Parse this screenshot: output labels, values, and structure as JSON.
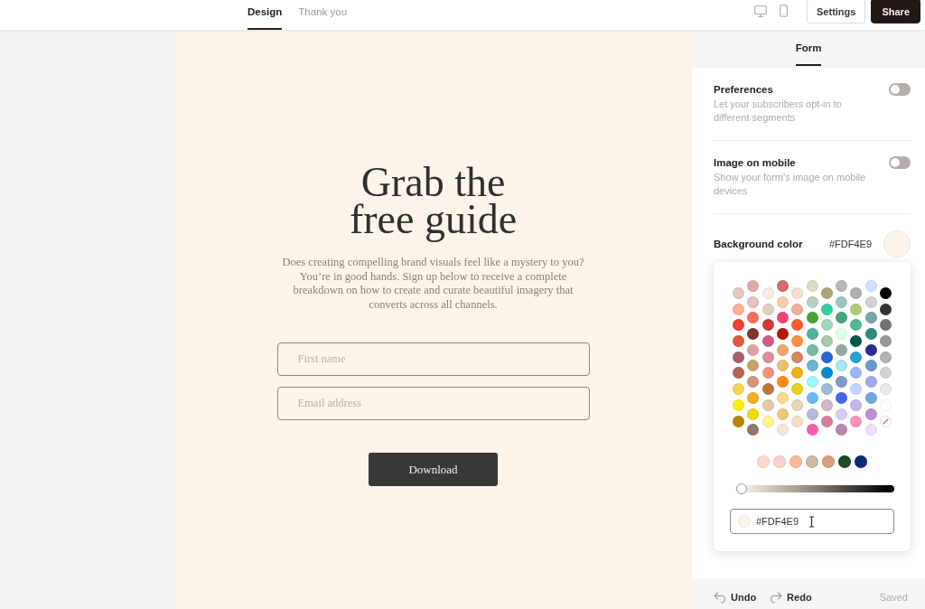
{
  "top_bar": {
    "tabs": [
      {
        "label": "Design",
        "selected": true
      },
      {
        "label": "Thank you",
        "selected": false
      }
    ],
    "buttons": [
      {
        "label": "Settings",
        "kind": "outline"
      },
      {
        "label": "Share",
        "kind": "primary"
      }
    ]
  },
  "canvas": {
    "heading": "Grab the free guide",
    "description": "Does creating compelling brand visuals feel like a mystery to you? You’re in good hands. Sign up below to receive a complete breakdown on how to create and curate beautiful imagery that converts across all channels.",
    "fields": [
      {
        "placeholder": "First name"
      },
      {
        "placeholder": "Email address"
      }
    ],
    "button": "Download"
  },
  "panel": {
    "tabs": [
      {
        "label": "Form",
        "selected": true
      }
    ],
    "settings": [
      {
        "title": "Preferences",
        "description": "Let your subscribers opt-in to different segments",
        "on": false
      },
      {
        "title": "Image on mobile",
        "description": "Show your form's image on mobile devices",
        "on": false
      }
    ],
    "background_color": {
      "label": "Background color",
      "value": "#FDF4E9",
      "color": "#fdf4e9"
    },
    "color_picker": {
      "palette": [
        {
          "swatches": [
            {
              "color": "#e6c8bf"
            },
            {
              "color": "#fcb095"
            },
            {
              "color": "#f43c2f"
            },
            {
              "color": "#e2573c"
            },
            {
              "color": "#a8606d"
            },
            {
              "color": "#ba6253"
            },
            {
              "color": "#f6d352"
            },
            {
              "color": "#fff000"
            },
            {
              "color": "#b8860b"
            }
          ]
        },
        {
          "swatches": [
            {
              "color": "#dfa9a1"
            },
            {
              "color": "#ebc0c0"
            },
            {
              "color": "#fe6a5a"
            },
            {
              "color": "#7b3a28"
            },
            {
              "color": "#dea2a5"
            },
            {
              "color": "#c9a26a"
            },
            {
              "color": "#d4967a"
            },
            {
              "color": "#eeb01c"
            },
            {
              "color": "#f7d900"
            },
            {
              "color": "#8f786c"
            }
          ]
        },
        {
          "swatches": [
            {
              "color": "#f8ebe6"
            },
            {
              "color": "#ddd0c0"
            },
            {
              "color": "#d0383d"
            },
            {
              "color": "#d05a8a"
            },
            {
              "color": "#d88f9b"
            },
            {
              "color": "#ef937f"
            },
            {
              "color": "#b7773e"
            },
            {
              "color": "#e7c8ae"
            },
            {
              "color": "#fff38a"
            }
          ]
        },
        {
          "swatches": [
            {
              "color": "#d46a6a"
            },
            {
              "color": "#fccba8"
            },
            {
              "color": "#ff4179"
            },
            {
              "color": "#b11a00"
            },
            {
              "color": "#eca674"
            },
            {
              "color": "#e8c36a"
            },
            {
              "color": "#ff8c10"
            },
            {
              "color": "#f8db8c"
            },
            {
              "color": "#ecc878"
            },
            {
              "color": "#f2e6d8"
            }
          ]
        },
        {
          "swatches": [
            {
              "color": "#f9dcd6"
            },
            {
              "color": "#eeae98"
            },
            {
              "color": "#fb5c27"
            },
            {
              "color": "#fe8e3d"
            },
            {
              "color": "#d8845c"
            },
            {
              "color": "#f0b01a"
            },
            {
              "color": "#e8d020"
            },
            {
              "color": "#e2d8bc"
            },
            {
              "color": "#f5ddc0"
            }
          ]
        },
        {
          "swatches": [
            {
              "color": "#dfdac2"
            },
            {
              "color": "#b8cfc0"
            },
            {
              "color": "#44a532"
            },
            {
              "color": "#52b09f"
            },
            {
              "color": "#74b8a6"
            },
            {
              "color": "#6bb6cf"
            },
            {
              "color": "#a0fafa"
            },
            {
              "color": "#6fb8f5"
            },
            {
              "color": "#b3bbdd"
            },
            {
              "color": "#ff5fa8"
            }
          ]
        },
        {
          "swatches": [
            {
              "color": "#a8a67d"
            },
            {
              "color": "#2ecf9e"
            },
            {
              "color": "#9dd9b9"
            },
            {
              "color": "#acc8ac"
            },
            {
              "color": "#2c64d4"
            },
            {
              "color": "#0288d1"
            },
            {
              "color": "#9bbad6"
            },
            {
              "color": "#d0b8c8"
            },
            {
              "color": "#d87c9c"
            }
          ]
        },
        {
          "swatches": [
            {
              "color": "#b2bcb0"
            },
            {
              "color": "#9ac4c8"
            },
            {
              "color": "#45a57d"
            },
            {
              "color": "#dcffe6"
            },
            {
              "color": "#93a8a0"
            },
            {
              "color": "#a2e8ee"
            },
            {
              "color": "#8098c8"
            },
            {
              "color": "#4864e8"
            },
            {
              "color": "#d8cdf0"
            },
            {
              "color": "#b58aac"
            }
          ]
        },
        {
          "swatches": [
            {
              "color": "#adadad"
            },
            {
              "color": "#b1c87a"
            },
            {
              "color": "#52b793"
            },
            {
              "color": "#005848"
            },
            {
              "color": "#2ba0d4"
            },
            {
              "color": "#98b5ff"
            },
            {
              "color": "#c5d5ff"
            },
            {
              "color": "#c6b5e6"
            },
            {
              "color": "#f594bb"
            }
          ]
        },
        {
          "swatches": [
            {
              "color": "#cfe2fe"
            },
            {
              "color": "#cfd3d0"
            },
            {
              "color": "#70a8ae"
            },
            {
              "color": "#2f887a"
            },
            {
              "color": "#2e2d8e"
            },
            {
              "color": "#6898c8"
            },
            {
              "color": "#9dacea"
            },
            {
              "color": "#74a8dc"
            },
            {
              "color": "#c08fd4"
            },
            {
              "color": "#f0dcfa"
            }
          ]
        },
        {
          "swatches": [
            {
              "color": "#000000"
            },
            {
              "color": "#343434"
            },
            {
              "color": "#727272"
            },
            {
              "color": "#979797"
            },
            {
              "color": "#b3b3b3"
            },
            {
              "color": "#d3d3d3"
            },
            {
              "color": "#e8e8e8"
            },
            {
              "color": "#ffffff"
            }
          ]
        }
      ],
      "clear_option": true,
      "recent": [
        {
          "color": "#fcd8cc"
        },
        {
          "color": "#fbd2c8"
        },
        {
          "color": "#fbb99c"
        },
        {
          "color": "#cbb9a0"
        },
        {
          "color": "#d8a07c"
        },
        {
          "color": "#1a4a30"
        },
        {
          "color": "#0e2a78"
        }
      ],
      "shade": {
        "level": 0.05
      },
      "hex_field": {
        "value": "#FDF4E9",
        "color": "#fdf4e9"
      }
    },
    "footer": {
      "undo": "Undo",
      "redo": "Redo",
      "status": "Saved"
    }
  }
}
